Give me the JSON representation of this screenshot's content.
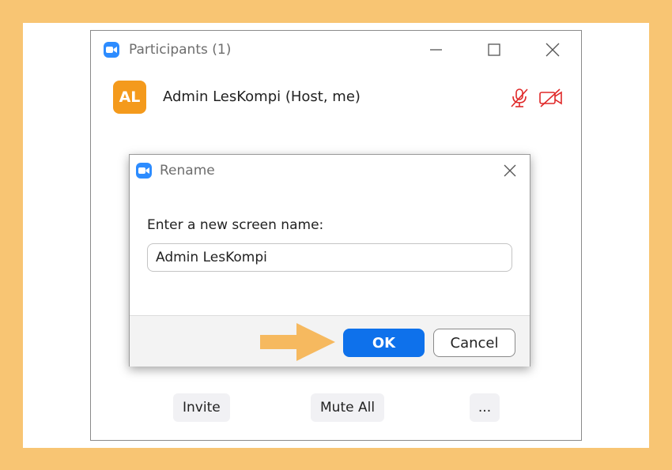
{
  "participants_window": {
    "title": "Participants (1)",
    "participant": {
      "initials": "AL",
      "name": "Admin LesKompi (Host, me)",
      "avatar_color": "#f49a1c",
      "status_icons": [
        "mic-muted-icon",
        "video-off-icon"
      ]
    },
    "footer": {
      "invite_label": "Invite",
      "mute_all_label": "Mute All",
      "more_label": "..."
    }
  },
  "rename_dialog": {
    "title": "Rename",
    "prompt": "Enter a new screen name:",
    "input_value": "Admin LesKompi",
    "ok_label": "OK",
    "cancel_label": "Cancel"
  },
  "colors": {
    "frame_background": "#f8c573",
    "accent_blue": "#0e71eb",
    "zoom_icon_blue": "#2d8cff",
    "status_red": "#e02828",
    "arrow_orange": "#f6b95f"
  }
}
